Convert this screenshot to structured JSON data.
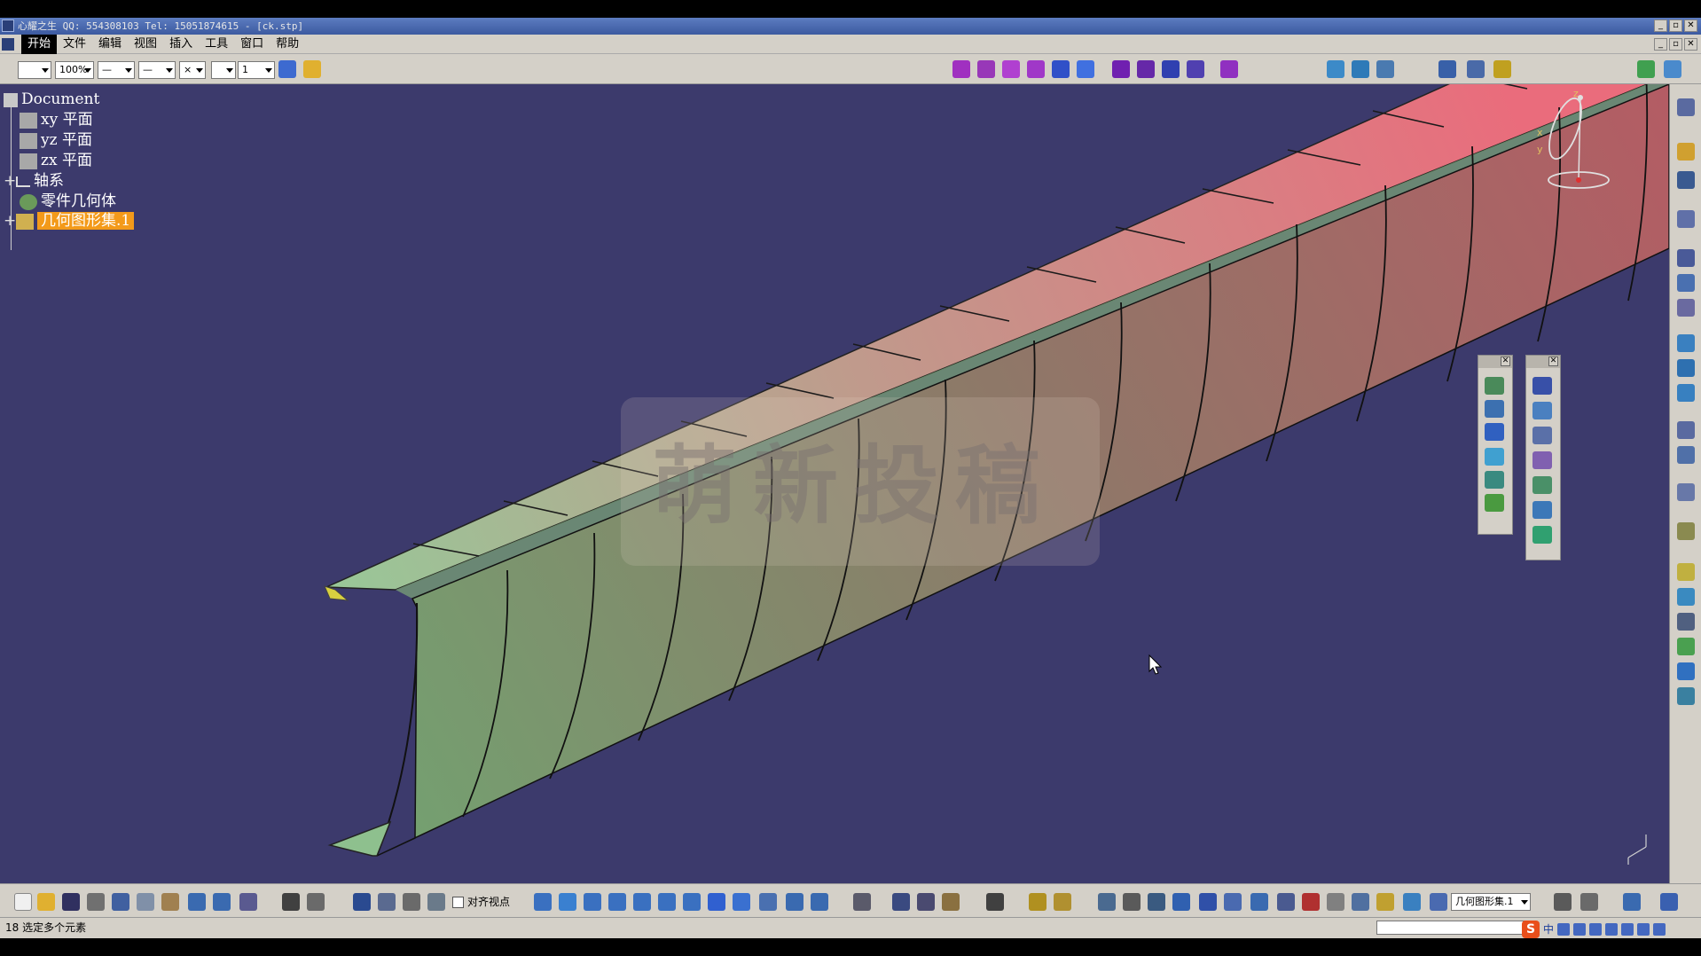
{
  "window": {
    "title": "心耀之生 QQ: 554308103 Tel: 15051874615 - [ck.stp]"
  },
  "menubar": {
    "items": [
      "开始",
      "文件",
      "编辑",
      "视图",
      "插入",
      "工具",
      "窗口",
      "帮助"
    ],
    "active_index": 0
  },
  "toolbar_top": {
    "zoom_value": "100%",
    "line_width_value": "1"
  },
  "spec_tree": {
    "root": "Document",
    "nodes": [
      {
        "label": "xy 平面",
        "icon": "plane-icon"
      },
      {
        "label": "yz 平面",
        "icon": "plane-icon"
      },
      {
        "label": "zx 平面",
        "icon": "plane-icon"
      },
      {
        "label": "轴系",
        "icon": "axis-system-icon"
      },
      {
        "label": "零件几何体",
        "icon": "part-body-icon"
      },
      {
        "label": "几何图形集.1",
        "icon": "geometric-set-icon",
        "selected": true
      }
    ]
  },
  "viewport": {
    "background_color": "#3c3a6c",
    "watermark_text": "萌新投稿",
    "compass_labels": {
      "x": "x",
      "y": "y",
      "z": "z"
    }
  },
  "toolbar_bottom": {
    "align_view_checkbox_label": "对齐视点",
    "current_set_value": "几何图形集.1"
  },
  "statusbar": {
    "text": "18 选定多个元素",
    "ime_label": "中"
  },
  "colors": {
    "part_green": "#8ec08e",
    "part_red": "#d86870",
    "ui_gray": "#d4d0c8",
    "selection_orange": "#f39a1a"
  }
}
